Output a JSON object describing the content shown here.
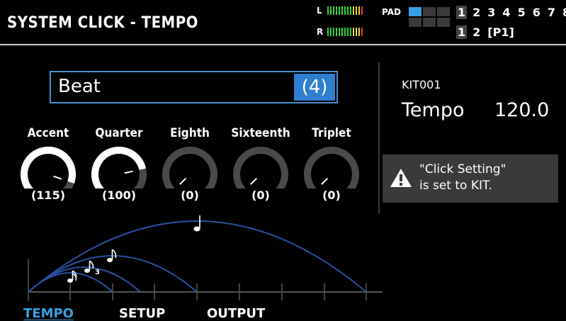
{
  "header": {
    "title": "SYSTEM CLICK - TEMPO",
    "meter_left_label": "L",
    "meter_right_label": "R",
    "pad_label": "PAD",
    "kit_numbers": [
      "1",
      "2",
      "3",
      "4",
      "5",
      "6",
      "7",
      "8"
    ],
    "bank_numbers": [
      "1",
      "2"
    ],
    "bank_page": "[P1]"
  },
  "beat": {
    "label": "Beat",
    "value": "(4)"
  },
  "knobs": [
    {
      "label": "Accent",
      "value": "(115)",
      "level": 115
    },
    {
      "label": "Quarter",
      "value": "(100)",
      "level": 100
    },
    {
      "label": "Eighth",
      "value": "(0)",
      "level": 0
    },
    {
      "label": "Sixteenth",
      "value": "(0)",
      "level": 0
    },
    {
      "label": "Triplet",
      "value": "(0)",
      "level": 0
    }
  ],
  "kit": {
    "name": "KIT001",
    "tempo_label": "Tempo",
    "tempo_value": "120.0"
  },
  "warning": {
    "text": "\"Click Setting\"\nis set to KIT."
  },
  "tabs": [
    {
      "label": "TEMPO",
      "active": true
    },
    {
      "label": "SETUP",
      "active": false
    },
    {
      "label": "OUTPUT",
      "active": false
    }
  ],
  "colors": {
    "accent": "#3aa0e6",
    "knob_active": "#ffffff",
    "knob_inactive": "#4a4a4a",
    "arc_line": "#2a4fa0"
  }
}
